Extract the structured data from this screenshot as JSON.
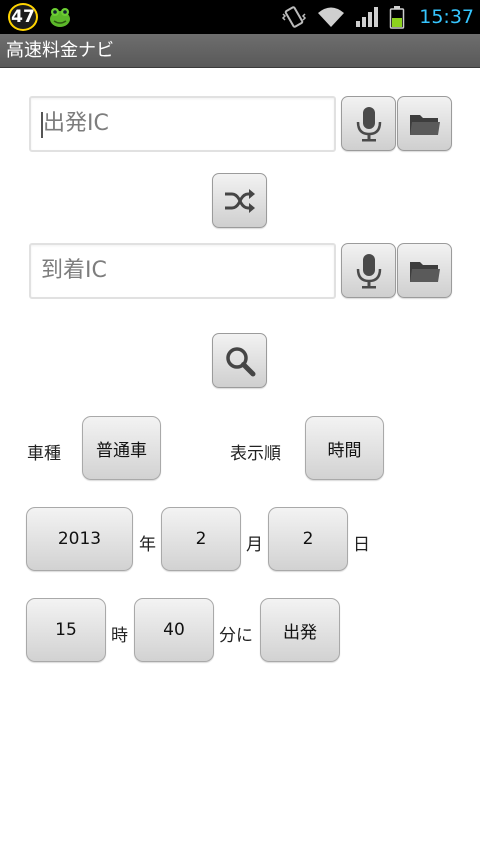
{
  "status_bar": {
    "badge": "47",
    "time": "15:37"
  },
  "title_bar": {
    "title": "高速料金ナビ"
  },
  "departure": {
    "placeholder": "出発IC"
  },
  "arrival": {
    "placeholder": "到着IC"
  },
  "options": {
    "vehicle_label": "車種",
    "vehicle_value": "普通車",
    "sort_label": "表示順",
    "sort_value": "時間"
  },
  "date": {
    "year": "2013",
    "year_unit": "年",
    "month": "2",
    "month_unit": "月",
    "day": "2",
    "day_unit": "日"
  },
  "time": {
    "hour": "15",
    "hour_unit": "時",
    "minute": "40",
    "minute_unit": "分に",
    "mode": "出発"
  },
  "colors": {
    "statusbar_bg": "#000000",
    "clock": "#36c6ff",
    "title_bg": "#666666"
  }
}
